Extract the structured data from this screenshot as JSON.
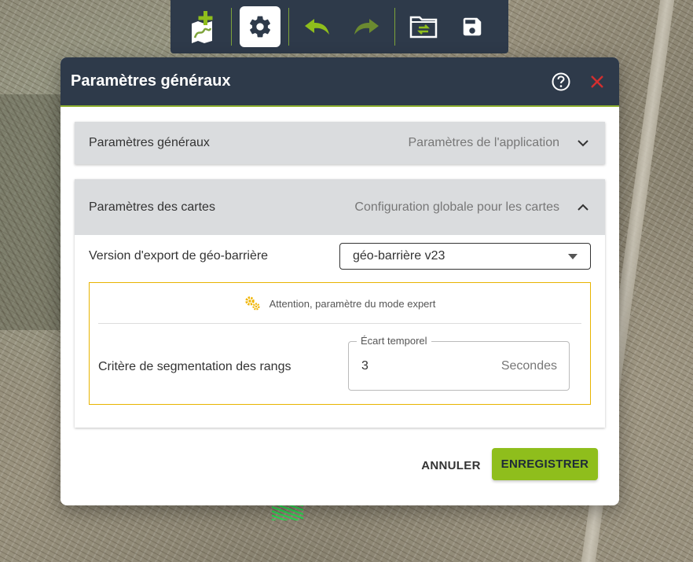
{
  "toolbar": {
    "buttons": [
      {
        "icon": "add-map-icon"
      },
      {
        "icon": "gear-icon",
        "active": true
      },
      {
        "icon": "undo-icon"
      },
      {
        "icon": "redo-icon"
      },
      {
        "icon": "folder-swap-icon"
      },
      {
        "icon": "save-icon"
      }
    ]
  },
  "dialog": {
    "title": "Paramètres généraux",
    "help_icon": "help-circle-icon",
    "close_icon": "close-icon"
  },
  "panel_general": {
    "title": "Paramètres généraux",
    "subtitle": "Paramètres de l'application",
    "expanded": false
  },
  "panel_maps": {
    "title": "Paramètres des cartes",
    "subtitle": "Configuration globale pour les cartes",
    "expanded": true,
    "version_label": "Version d'export de géo-barrière",
    "version_value": "géo-barrière v23",
    "expert_warning": "Attention, paramètre du mode expert",
    "segmentation_label": "Critère de segmentation des rangs",
    "ecart_legend": "Écart temporel",
    "ecart_value": "3",
    "ecart_unit": "Secondes"
  },
  "actions": {
    "cancel": "ANNULER",
    "save": "ENREGISTRER"
  },
  "colors": {
    "header": "#2e3a4a",
    "accent": "#8fbe1c",
    "warning": "#e8b400",
    "close": "#d32f2f"
  }
}
